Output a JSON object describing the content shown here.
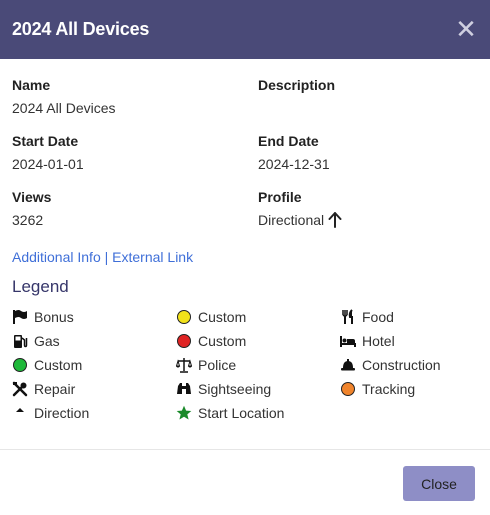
{
  "header": {
    "title": "2024 All Devices",
    "close_glyph": "✕"
  },
  "fields": {
    "name_label": "Name",
    "name_value": "2024 All Devices",
    "description_label": "Description",
    "description_value": "",
    "start_label": "Start Date",
    "start_value": "2024-01-01",
    "end_label": "End Date",
    "end_value": "2024-12-31",
    "views_label": "Views",
    "views_value": "3262",
    "profile_label": "Profile",
    "profile_value": "Directional"
  },
  "links": {
    "additional": "Additional Info",
    "separator": "|",
    "external": "External Link",
    "color": "#3f6fd8"
  },
  "legend": {
    "title": "Legend",
    "items": [
      {
        "label": "Bonus",
        "icon": "flag-icon"
      },
      {
        "label": "Custom",
        "icon": "yellow-dot-icon",
        "color": "#f2e21a"
      },
      {
        "label": "Food",
        "icon": "utensils-icon"
      },
      {
        "label": "Gas",
        "icon": "gas-pump-icon"
      },
      {
        "label": "Custom",
        "icon": "red-dot-icon",
        "color": "#e02424"
      },
      {
        "label": "Hotel",
        "icon": "bed-icon"
      },
      {
        "label": "Custom",
        "icon": "green-dot-icon",
        "color": "#1fb83a"
      },
      {
        "label": "Police",
        "icon": "scales-icon"
      },
      {
        "label": "Construction",
        "icon": "hard-hat-icon"
      },
      {
        "label": "Repair",
        "icon": "tools-icon"
      },
      {
        "label": "Sightseeing",
        "icon": "binoculars-icon"
      },
      {
        "label": "Tracking",
        "icon": "orange-dot-icon",
        "color": "#f0842c"
      },
      {
        "label": "Direction",
        "icon": "caret-up-icon"
      },
      {
        "label": "Start Location",
        "icon": "star-icon",
        "color": "#1a8a2a"
      }
    ]
  },
  "footer": {
    "close_label": "Close"
  },
  "colors": {
    "header_bg": "#4a4a78",
    "button_bg": "#8e8ec6",
    "legend_title": "#36366a"
  }
}
